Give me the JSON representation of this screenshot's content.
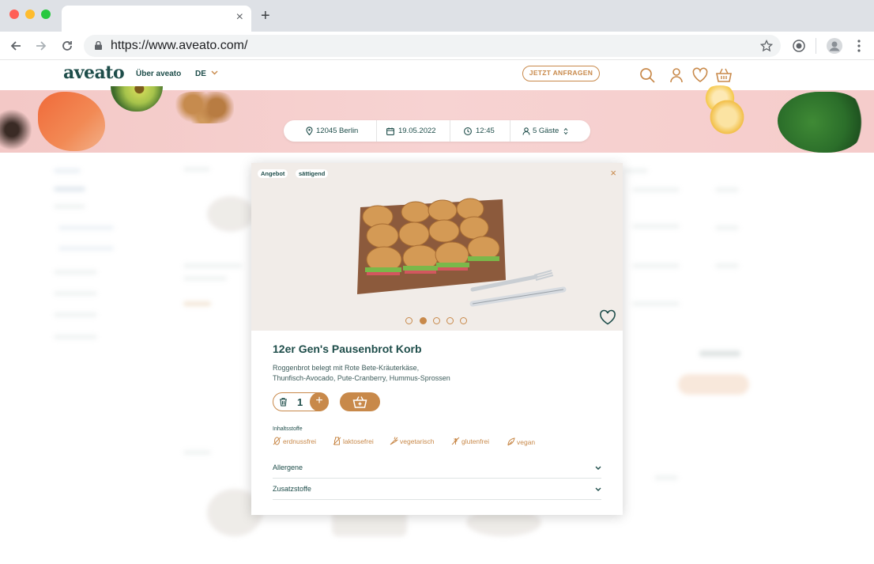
{
  "browser": {
    "url": "https://www.aveato.com/",
    "tab_close": "×",
    "new_tab": "+"
  },
  "header": {
    "logo": "aveato",
    "nav_about": "Über aveato",
    "language": "DE",
    "cta": "JETZT ANFRAGEN"
  },
  "search": {
    "location": "12045 Berlin",
    "date": "19.05.2022",
    "time": "12:45",
    "guests": "5 Gäste"
  },
  "modal": {
    "tags": [
      "Angebot",
      "sättigend"
    ],
    "close": "×",
    "carousel": {
      "count": 5,
      "active_index": 1
    },
    "title": "12er Gen's Pausenbrot Korb",
    "description_line1": "Roggenbrot belegt mit Rote Bete-Kräuterkäse,",
    "description_line2": "Thunfisch-Avocado, Pute-Cranberry, Hummus-Sprossen",
    "quantity": "1",
    "plus": "+",
    "ingredients_label": "Inhaltsstoffe",
    "attributes": [
      "erdnussfrei",
      "laktosefrei",
      "vegetarisch",
      "glutenfrei",
      "vegan"
    ],
    "accordions": [
      "Allergene",
      "Zusatzstoffe"
    ],
    "chevron": "⌄"
  },
  "colors": {
    "brand_teal": "#1e4d4a",
    "accent": "#c8894a",
    "hero_pink": "#f5cccb"
  }
}
